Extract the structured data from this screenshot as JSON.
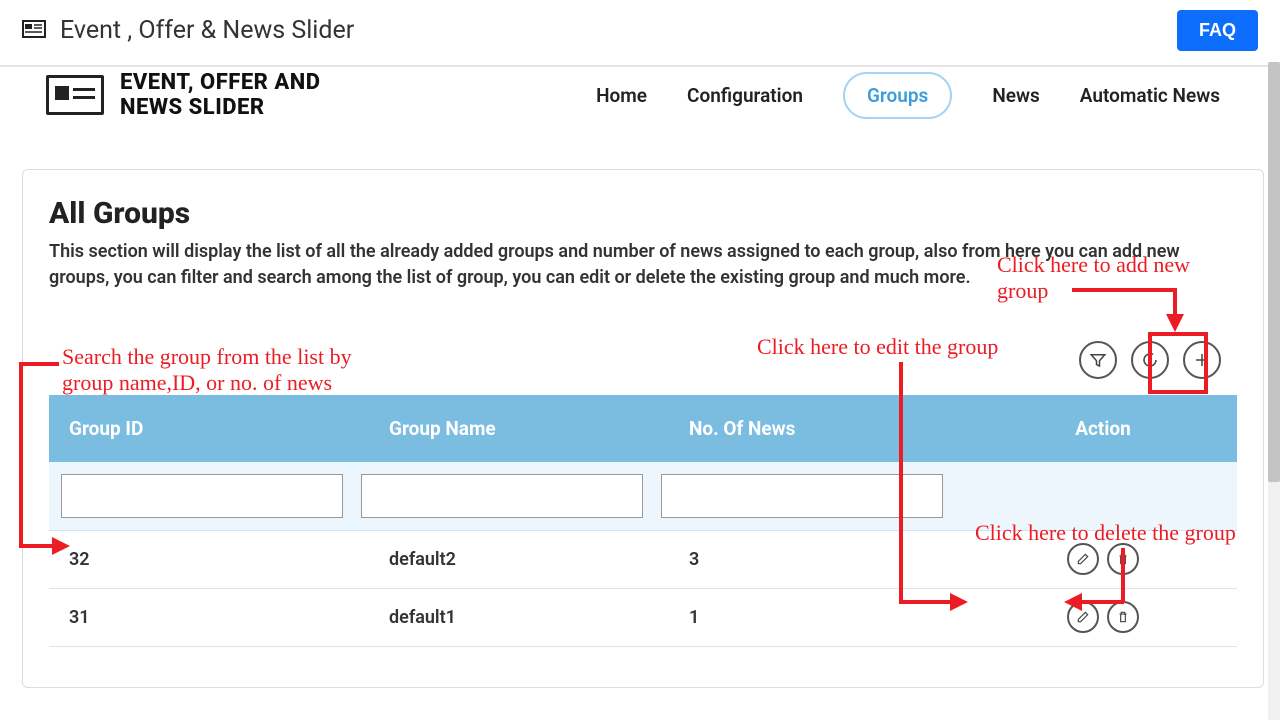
{
  "topbar": {
    "title": "Event , Offer & News Slider",
    "faq": "FAQ"
  },
  "logo": {
    "line1": "EVENT, OFFER AND",
    "line2": "NEWS SLIDER"
  },
  "nav": {
    "home": "Home",
    "configuration": "Configuration",
    "groups": "Groups",
    "news": "News",
    "automatic_news": "Automatic News"
  },
  "panel": {
    "title": "All Groups",
    "desc": "This section will display the list of all the already added groups and number of news assigned to each group, also from here you can add new groups, you can filter and search among the list of group, you can edit or delete the existing group and much more."
  },
  "table": {
    "headers": {
      "id": "Group ID",
      "name": "Group Name",
      "news": "No. Of News",
      "action": "Action"
    },
    "rows": [
      {
        "id": "32",
        "name": "default2",
        "news": "3"
      },
      {
        "id": "31",
        "name": "default1",
        "news": "1"
      }
    ]
  },
  "annotations": {
    "add_new": "Click here to add new group",
    "search": "Search the group from the list by group name,ID, or no. of news",
    "edit": "Click here to edit the group",
    "delete": "Click here to delete the group"
  }
}
